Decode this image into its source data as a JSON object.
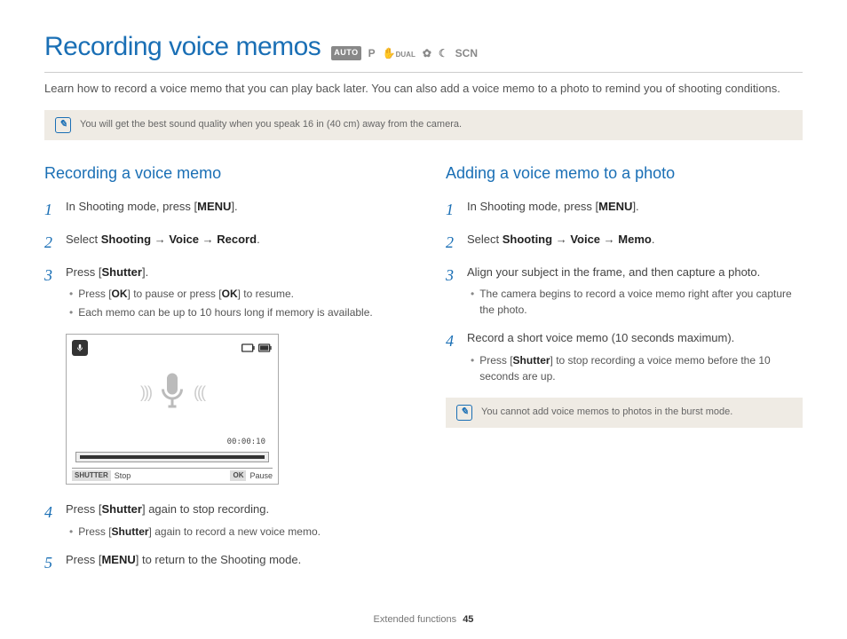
{
  "title": "Recording voice memos",
  "modes": {
    "auto": "AUTO",
    "p": "P",
    "dual": "DUAL",
    "scn": "SCN"
  },
  "intro": "Learn how to record a voice memo that you can play back later. You can also add a voice memo to a photo to remind you of shooting conditions.",
  "topNote": "You will get the best sound quality when you speak 16 in (40 cm) away from the camera.",
  "left": {
    "heading": "Recording a voice memo",
    "step1_a": "In Shooting mode, press [",
    "step1_b": "MENU",
    "step1_c": "].",
    "step2_a": "Select ",
    "step2_b": "Shooting",
    "step2_arrow": " → ",
    "step2_c": "Voice",
    "step2_d": "Record",
    "step2_e": ".",
    "step3_a": "Press [",
    "step3_b": "Shutter",
    "step3_c": "].",
    "step3_bul1_a": "Press [",
    "step3_bul1_b": "OK",
    "step3_bul1_c": "] to pause or press [",
    "step3_bul1_d": "OK",
    "step3_bul1_e": "] to resume.",
    "step3_bul2": "Each memo can be up to 10 hours long if memory is available.",
    "screen": {
      "time": "00:00:10",
      "shutterTag": "SHUTTER",
      "stop": "Stop",
      "okTag": "OK",
      "pause": "Pause"
    },
    "step4_a": "Press [",
    "step4_b": "Shutter",
    "step4_c": "] again to stop recording.",
    "step4_bul_a": "Press [",
    "step4_bul_b": "Shutter",
    "step4_bul_c": "] again to record a new voice memo.",
    "step5_a": "Press [",
    "step5_b": "MENU",
    "step5_c": "] to return to the Shooting mode."
  },
  "right": {
    "heading": "Adding a voice memo to a photo",
    "step1_a": "In Shooting mode, press [",
    "step1_b": "MENU",
    "step1_c": "].",
    "step2_a": "Select ",
    "step2_b": "Shooting",
    "step2_arrow": " → ",
    "step2_c": "Voice",
    "step2_d": "Memo",
    "step2_e": ".",
    "step3": "Align your subject in the frame, and then capture a photo.",
    "step3_bul": "The camera begins to record a voice memo right after you capture the photo.",
    "step4": "Record a short voice memo (10 seconds maximum).",
    "step4_bul_a": "Press [",
    "step4_bul_b": "Shutter",
    "step4_bul_c": "] to stop recording a voice memo before the 10 seconds are up.",
    "note": "You cannot add voice memos to photos in the burst mode."
  },
  "footer": {
    "section": "Extended functions",
    "page": "45"
  }
}
